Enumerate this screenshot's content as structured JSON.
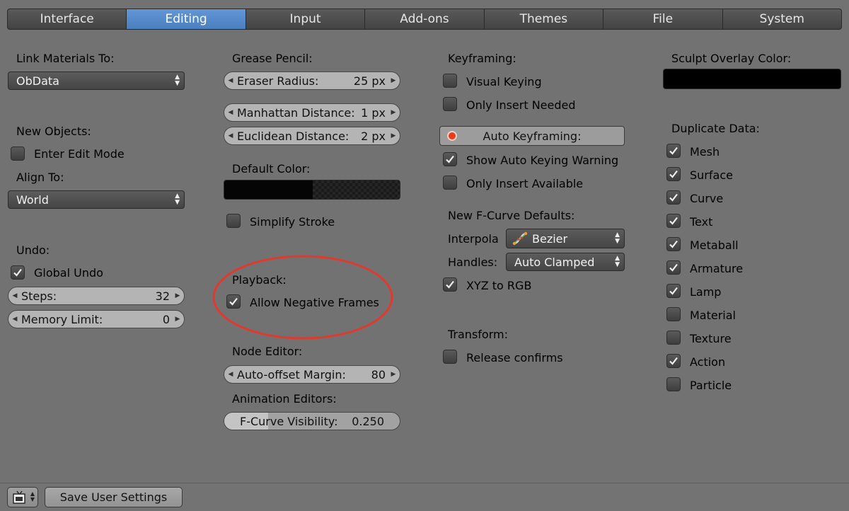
{
  "tabs": [
    "Interface",
    "Editing",
    "Input",
    "Add-ons",
    "Themes",
    "File",
    "System"
  ],
  "active_tab": 1,
  "col1": {
    "link_materials_label": "Link Materials To:",
    "link_materials_value": "ObData",
    "new_objects_label": "New Objects:",
    "enter_edit_mode": "Enter Edit Mode",
    "align_to_label": "Align To:",
    "align_to_value": "World",
    "undo_label": "Undo:",
    "global_undo": "Global Undo",
    "steps_label": "Steps:",
    "steps_value": "32",
    "memory_label": "Memory Limit:",
    "memory_value": "0"
  },
  "col2": {
    "grease_pencil_label": "Grease Pencil:",
    "eraser_label": "Eraser Radius:",
    "eraser_value": "25 px",
    "manhattan_label": "Manhattan Distance:",
    "manhattan_value": "1 px",
    "euclidean_label": "Euclidean Distance:",
    "euclidean_value": "2 px",
    "default_color_label": "Default Color:",
    "simplify_stroke": "Simplify Stroke",
    "playback_label": "Playback:",
    "allow_negative": "Allow Negative Frames",
    "node_editor_label": "Node Editor:",
    "auto_offset_label": "Auto-offset Margin:",
    "auto_offset_value": "80",
    "anim_editors_label": "Animation Editors:",
    "fcurve_label": "F-Curve Visibility:",
    "fcurve_value": "0.250",
    "fcurve_fraction": 0.25
  },
  "col3": {
    "keyframing_label": "Keyframing:",
    "visual_keying": "Visual Keying",
    "only_insert_needed": "Only Insert Needed",
    "auto_keyframing": "Auto Keyframing:",
    "show_auto_warning": "Show Auto Keying Warning",
    "only_insert_available": "Only Insert Available",
    "fcurve_defaults_label": "New F-Curve Defaults:",
    "interpola_label": "Interpola",
    "interpola_value": "Bezier",
    "handles_label": "Handles:",
    "handles_value": "Auto Clamped",
    "xyz_to_rgb": "XYZ to RGB",
    "transform_label": "Transform:",
    "release_confirms": "Release confirms"
  },
  "col4": {
    "sculpt_label": "Sculpt Overlay Color:",
    "duplicate_label": "Duplicate Data:",
    "items": [
      {
        "label": "Mesh",
        "checked": true
      },
      {
        "label": "Surface",
        "checked": true
      },
      {
        "label": "Curve",
        "checked": true
      },
      {
        "label": "Text",
        "checked": true
      },
      {
        "label": "Metaball",
        "checked": true
      },
      {
        "label": "Armature",
        "checked": true
      },
      {
        "label": "Lamp",
        "checked": true
      },
      {
        "label": "Material",
        "checked": false
      },
      {
        "label": "Texture",
        "checked": false
      },
      {
        "label": "Action",
        "checked": true
      },
      {
        "label": "Particle",
        "checked": false
      }
    ]
  },
  "footer": {
    "save_label": "Save User Settings"
  },
  "colors": {
    "highlight_circle": "#e03a2f",
    "active_tab": "#5a8ccc"
  }
}
